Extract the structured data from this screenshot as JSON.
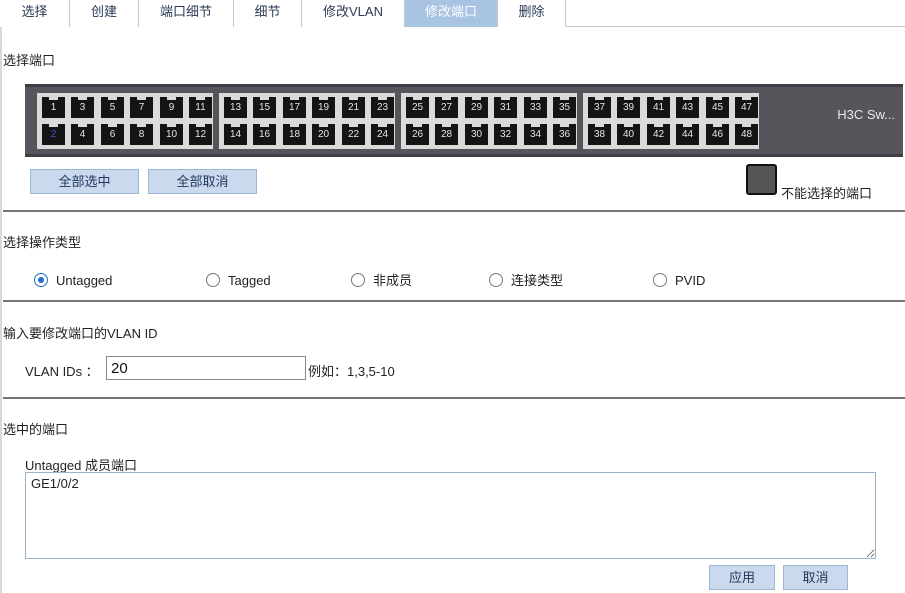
{
  "tabs": [
    {
      "label": "选择"
    },
    {
      "label": "创建"
    },
    {
      "label": "端口细节"
    },
    {
      "label": "细节"
    },
    {
      "label": "修改VLAN"
    },
    {
      "label": "修改端口",
      "active": true
    },
    {
      "label": "删除"
    }
  ],
  "select_ports": {
    "title": "选择端口",
    "brand": "H3C Sw...",
    "selected_port": "2",
    "groups": [
      {
        "top": [
          "1",
          "3",
          "5",
          "7",
          "9",
          "11"
        ],
        "bottom": [
          "2",
          "4",
          "6",
          "8",
          "10",
          "12"
        ]
      },
      {
        "top": [
          "13",
          "15",
          "17",
          "19",
          "21",
          "23"
        ],
        "bottom": [
          "14",
          "16",
          "18",
          "20",
          "22",
          "24"
        ]
      },
      {
        "top": [
          "25",
          "27",
          "29",
          "31",
          "33",
          "35"
        ],
        "bottom": [
          "26",
          "28",
          "30",
          "32",
          "34",
          "36"
        ]
      },
      {
        "top": [
          "37",
          "39",
          "41",
          "43",
          "45",
          "47"
        ],
        "bottom": [
          "38",
          "40",
          "42",
          "44",
          "46",
          "48"
        ]
      }
    ],
    "select_all_label": "全部选中",
    "deselect_all_label": "全部取消",
    "legend_unselectable": "不能选择的端口"
  },
  "operation": {
    "title": "选择操作类型",
    "options": [
      "Untagged",
      "Tagged",
      "非成员",
      "连接类型",
      "PVID"
    ],
    "selected": "Untagged"
  },
  "vlan": {
    "title": "输入要修改端口的VLAN ID",
    "label": "VLAN IDs ：",
    "value": "20",
    "example": "例如：1,3,5-10"
  },
  "selected_ports": {
    "title": "选中的端口",
    "untagged_label": "Untagged 成员端口",
    "untagged_value": "GE1/0/2"
  },
  "actions": {
    "apply_label": "应用",
    "cancel_label": "取消"
  },
  "colors": {
    "tab_active": "#a9c3e3",
    "button_bg": "#c9d9ee",
    "switch_body": "#55555b",
    "port": "#141414",
    "radio_checked": "#1f6fd6"
  }
}
